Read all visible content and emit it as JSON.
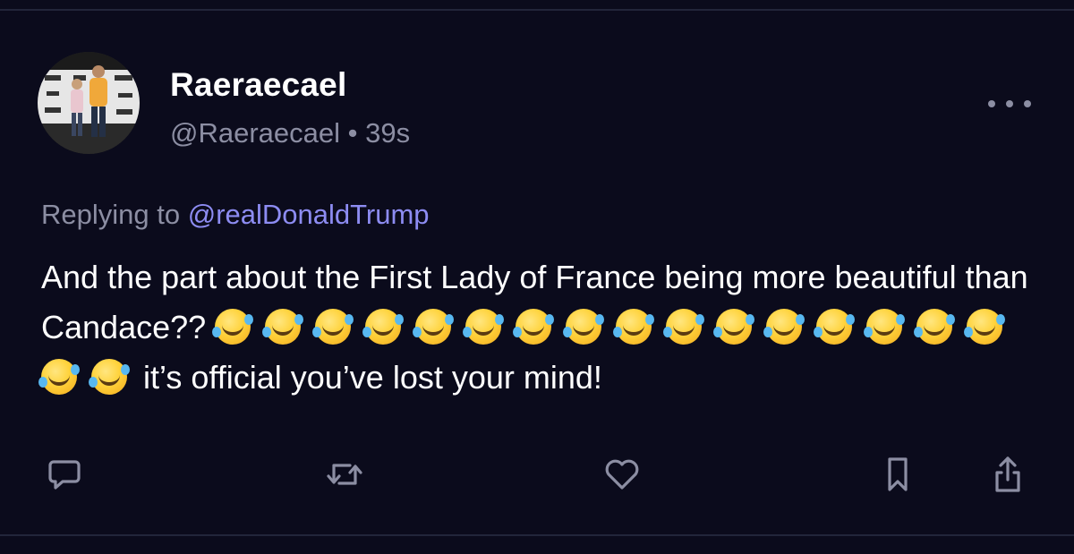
{
  "tweet": {
    "display_name": "Raeraecael",
    "handle": "@Raeraecael",
    "separator": "•",
    "time": "39s",
    "reply_prefix": "Replying to",
    "reply_handle": "@realDonaldTrump",
    "text_part1": "And the part about the First Lady of France being more beautiful than Candace??",
    "emoji": "🤣",
    "emoji_count": 18,
    "text_part2": "it’s official you’ve lost your mind!"
  },
  "icons": {
    "more": "more-dots-icon",
    "reply": "comment-icon",
    "retweet": "retweet-icon",
    "like": "heart-icon",
    "bookmark": "bookmark-icon",
    "share": "share-icon"
  },
  "colors": {
    "background": "#0b0b1c",
    "muted": "#8c8ea3",
    "link": "#8d8cf2",
    "text": "#ffffff"
  }
}
